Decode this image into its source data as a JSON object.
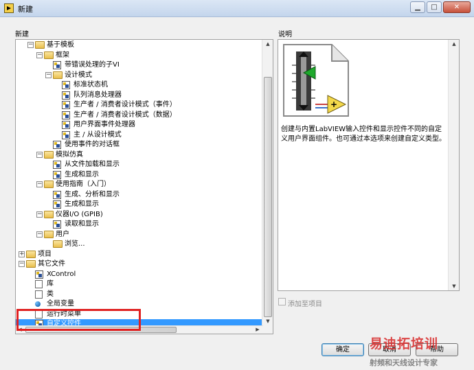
{
  "window": {
    "title": "新建"
  },
  "left_panel": {
    "label": "新建",
    "tree": [
      {
        "label": "基于模板",
        "icon": "folder-icon",
        "expanded": true,
        "level": 1
      },
      {
        "label": "框架",
        "icon": "folder-icon",
        "expanded": true,
        "level": 2
      },
      {
        "label": "带错误处理的子VI",
        "icon": "vi-template-icon",
        "level": 3
      },
      {
        "label": "设计模式",
        "icon": "folder-icon",
        "expanded": true,
        "level": 3
      },
      {
        "label": "标准状态机",
        "icon": "vi-template-icon",
        "level": 4
      },
      {
        "label": "队列消息处理器",
        "icon": "vi-template-icon",
        "level": 4
      },
      {
        "label": "生产者 / 消费者设计模式（事件）",
        "icon": "vi-template-icon",
        "level": 4
      },
      {
        "label": "生产者 / 消费者设计模式（数据）",
        "icon": "vi-template-icon",
        "level": 4
      },
      {
        "label": "用户界面事件处理器",
        "icon": "vi-template-icon",
        "level": 4
      },
      {
        "label": "主 / 从设计模式",
        "icon": "vi-template-icon",
        "level": 4
      },
      {
        "label": "使用事件的对话框",
        "icon": "vi-template-icon",
        "level": 3
      },
      {
        "label": "模拟仿真",
        "icon": "folder-icon",
        "expanded": true,
        "level": 2
      },
      {
        "label": "从文件加载和显示",
        "icon": "vi-template-icon",
        "level": 3
      },
      {
        "label": "生成和显示",
        "icon": "vi-template-icon",
        "level": 3
      },
      {
        "label": "使用指南（入门）",
        "icon": "folder-icon",
        "expanded": true,
        "level": 2
      },
      {
        "label": "生成、分析和显示",
        "icon": "vi-template-icon",
        "level": 3
      },
      {
        "label": "生成和显示",
        "icon": "vi-template-icon",
        "level": 3
      },
      {
        "label": "仪器I/O (GPIB)",
        "icon": "folder-icon",
        "expanded": true,
        "level": 2
      },
      {
        "label": "读取和显示",
        "icon": "vi-template-icon",
        "level": 3
      },
      {
        "label": "用户",
        "icon": "folder-icon",
        "expanded": true,
        "level": 2
      },
      {
        "label": "浏览...",
        "icon": "folder-icon",
        "level": 3
      },
      {
        "label": "项目",
        "icon": "folder-icon",
        "expanded": false,
        "level": 0
      },
      {
        "label": "其它文件",
        "icon": "folder-icon",
        "expanded": true,
        "level": 0
      },
      {
        "label": "XControl",
        "icon": "xcontrol-icon",
        "level": 1
      },
      {
        "label": "库",
        "icon": "library-icon",
        "level": 1
      },
      {
        "label": "类",
        "icon": "class-icon",
        "level": 1
      },
      {
        "label": "全局变量",
        "icon": "globe-icon",
        "level": 1
      },
      {
        "label": "运行时菜单",
        "icon": "menu-file-icon",
        "level": 1
      },
      {
        "label": "自定义控件",
        "icon": "custom-control-icon",
        "level": 1,
        "selected": true
      }
    ]
  },
  "right_panel": {
    "label": "说明",
    "description": "创建与内置LabVIEW输入控件和显示控件不同的自定义用户界面组件。也可通过本选项来创建自定义类型。",
    "add_to_project_label": "添加至项目",
    "add_to_project_checked": false
  },
  "buttons": {
    "ok": "确定",
    "cancel": "取消",
    "help": "帮助"
  },
  "watermark": {
    "brand": "易迪拓培训",
    "subtitle": "射频和天线设计专家"
  },
  "colors": {
    "selection": "#3399ff",
    "highlight_box": "#e02020"
  }
}
